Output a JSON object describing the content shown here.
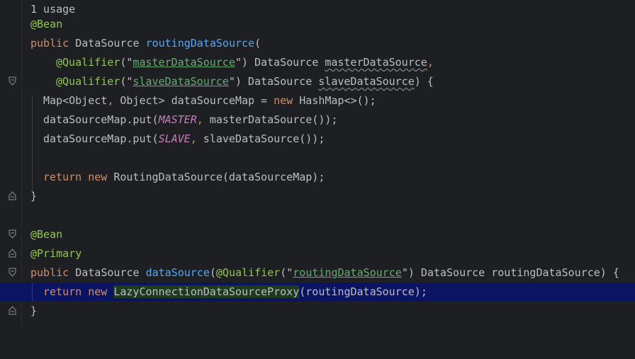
{
  "editor": {
    "usage_hint": "1 usage",
    "lines": {
      "l2": {
        "ann": "@Bean"
      },
      "l3": {
        "kw": "public",
        "type": "DataSource",
        "name": "routingDataSource",
        "open": "("
      },
      "l4": {
        "ann": "@Qualifier",
        "p1": "(\"",
        "str": "masterDataSource",
        "p2": "\")",
        "type": " DataSource ",
        "param": "masterDataSource",
        "comma": ","
      },
      "l5": {
        "ann": "@Qualifier",
        "p1": "(\"",
        "str": "slaveDataSource",
        "p2": "\")",
        "type": " DataSource ",
        "param": "slaveDataSource",
        "rest": ") {"
      },
      "l6": {
        "a": "Map<Object",
        "b": ",",
        "c": " Object> dataSourceMap = ",
        "kw": "new",
        "d": " HashMap<>();"
      },
      "l7": {
        "a": "dataSourceMap.put(",
        "const": "MASTER",
        "b": ",",
        "c": " masterDataSource());"
      },
      "l8": {
        "a": "dataSourceMap.put(",
        "const": "SLAVE",
        "b": ",",
        "c": " slaveDataSource());"
      },
      "l10": {
        "kw1": "return",
        "kw2": "new",
        "rest": " RoutingDataSource(dataSourceMap);"
      },
      "l11": {
        "text": "}"
      },
      "l13": {
        "ann": "@Bean"
      },
      "l14": {
        "ann": "@Primary"
      },
      "l15": {
        "kw": "public",
        "type": " DataSource ",
        "name": "dataSource",
        "p0": "(",
        "ann": "@Qualifier",
        "p1": "(\"",
        "str": "routingDataSource",
        "p2": "\")",
        "rest": " DataSource routingDataSource) {"
      },
      "l16": {
        "kw1": "return",
        "kw2": "new",
        "cls": "LazyConnectionDataSourceProxy",
        "rest": "(routingDataSource);"
      },
      "l17": {
        "text": "}"
      }
    }
  },
  "colors": {
    "background": "#1e1f22",
    "keyword": "#cf8e6d",
    "annotation": "#b3ae60",
    "string": "#6aab73",
    "constant": "#c77dbb",
    "current_line": "#0b1463"
  }
}
